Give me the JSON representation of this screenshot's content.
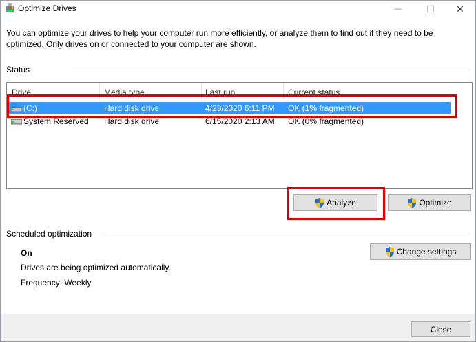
{
  "window": {
    "title": "Optimize Drives",
    "minimize_glyph": "—",
    "maximize_glyph": "☐",
    "close_glyph": "✕"
  },
  "description": "You can optimize your drives to help your computer run more efficiently, or analyze them to find out if they need to be optimized. Only drives on or connected to your computer are shown.",
  "status": {
    "label": "Status",
    "columns": [
      "Drive",
      "Media type",
      "Last run",
      "Current status"
    ],
    "rows": [
      {
        "drive": "(C:)",
        "media_type": "Hard disk drive",
        "last_run": "4/23/2020 6:11 PM",
        "current_status": "OK (1% fragmented)",
        "selected": true,
        "icon": "windows-drive-icon"
      },
      {
        "drive": "System Reserved",
        "media_type": "Hard disk drive",
        "last_run": "6/15/2020 2:13 AM",
        "current_status": "OK (0% fragmented)",
        "selected": false,
        "icon": "drive-icon"
      }
    ],
    "analyze_label": "Analyze",
    "optimize_label": "Optimize"
  },
  "schedule": {
    "label": "Scheduled optimization",
    "state": "On",
    "detail": "Drives are being optimized automatically.",
    "frequency": "Frequency: Weekly",
    "change_settings_label": "Change settings"
  },
  "footer": {
    "close_label": "Close"
  },
  "colors": {
    "selection": "#3399ff",
    "highlight": "#e00000",
    "button_face": "#e1e1e1"
  }
}
